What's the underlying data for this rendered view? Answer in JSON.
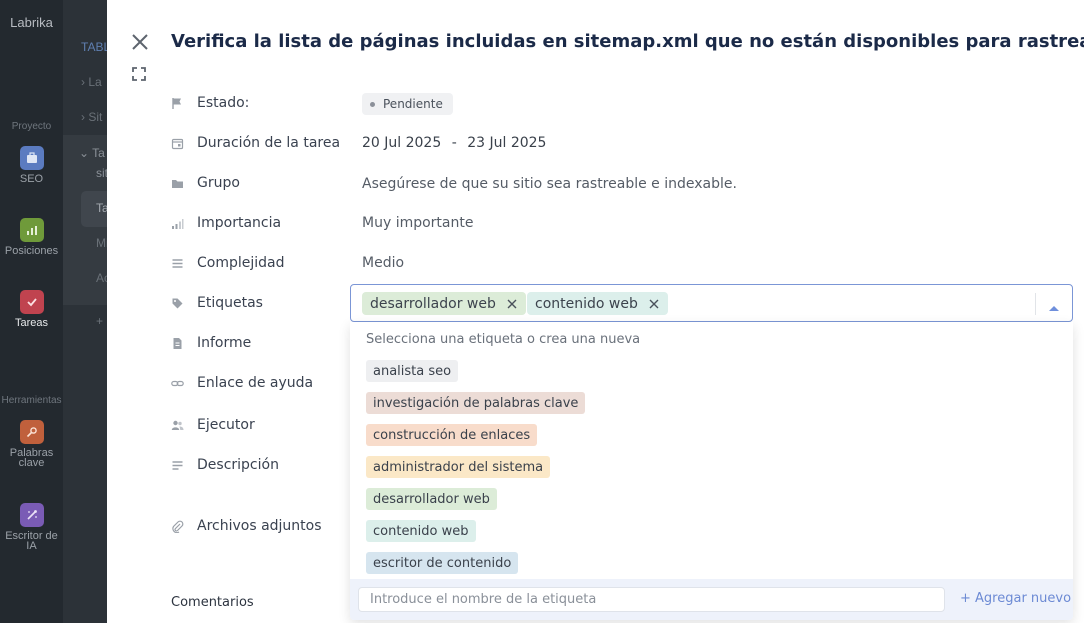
{
  "app": {
    "logo": "Labrika",
    "section_project": "Proyecto",
    "section_tools": "Herramientas",
    "nav": [
      {
        "label": "SEO",
        "color": "#5b7bc0"
      },
      {
        "label": "Posiciones",
        "color": "#6f9a3a"
      },
      {
        "label": "Tareas",
        "color": "#c0434f"
      },
      {
        "label": "Palabras clave",
        "color": "#c0603c"
      },
      {
        "label": "Escritor de IA",
        "color": "#7a5bb5"
      }
    ]
  },
  "sub_panel": {
    "items": [
      "TABL",
      "La",
      "Sit",
      "Ta",
      "sit",
      "Ta",
      "Mi",
      "Ac",
      "+"
    ]
  },
  "task": {
    "title": "Verifica la lista de páginas incluidas en sitemap.xml que no están disponibles para rastrear.",
    "fields": {
      "status_label": "Estado:",
      "status_value": "Pendiente",
      "duration_label": "Duración de la tarea",
      "duration_start": "20 Jul 2025",
      "duration_sep": "-",
      "duration_end": "23 Jul 2025",
      "group_label": "Grupo",
      "group_value": "Asegúrese de que su sitio sea rastreable e indexable.",
      "importance_label": "Importancia",
      "importance_value": "Muy importante",
      "complexity_label": "Complejidad",
      "complexity_value": "Medio",
      "tags_label": "Etiquetas",
      "report_label": "Informe",
      "help_link_label": "Enlace de ayuda",
      "executor_label": "Ejecutor",
      "description_label": "Descripción",
      "attachments_label": "Archivos adjuntos"
    },
    "comments_label": "Comentarios"
  },
  "tags": {
    "selected": [
      {
        "label": "desarrollador web",
        "color": "#dcecd8"
      },
      {
        "label": "contenido web",
        "color": "#dcefeb"
      }
    ],
    "dropdown_hint": "Selecciona una etiqueta o crea una nueva",
    "options": [
      {
        "label": "analista seo",
        "color": "#eeeff1"
      },
      {
        "label": "investigación de palabras clave",
        "color": "#ecdcd6"
      },
      {
        "label": "construcción de enlaces",
        "color": "#f8dccb"
      },
      {
        "label": "administrador del sistema",
        "color": "#fbe8c7"
      },
      {
        "label": "desarrollador web",
        "color": "#dcecd8"
      },
      {
        "label": "contenido web",
        "color": "#dcefeb"
      },
      {
        "label": "escritor de contenido",
        "color": "#d6e5ef"
      }
    ],
    "new_tag_placeholder": "Introduce el nombre de la etiqueta",
    "add_new_label": "+  Agregar nuevo"
  }
}
